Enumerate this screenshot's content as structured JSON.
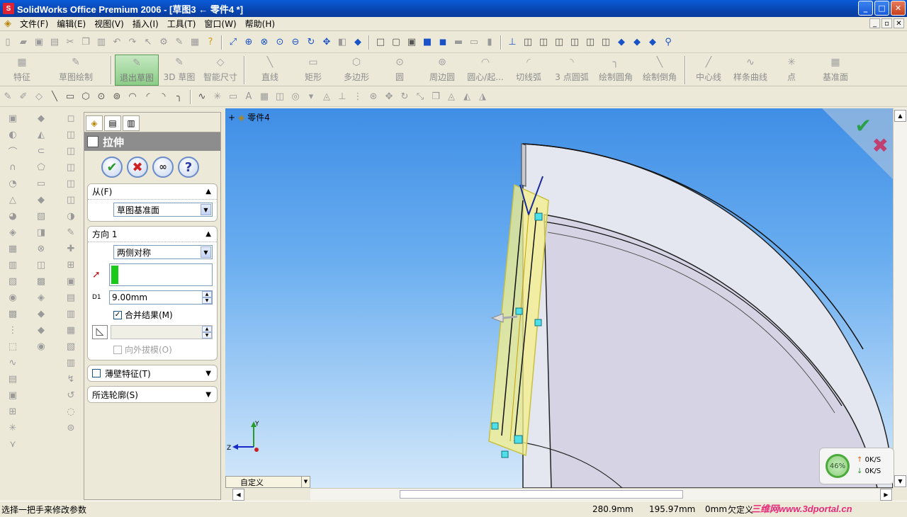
{
  "window": {
    "title": "SolidWorks Office Premium 2006 - [草图3 ← 零件4 *]",
    "app_icon": "S",
    "controls": [
      "_",
      "□",
      "✕"
    ]
  },
  "menu": {
    "items": [
      "文件(F)",
      "编辑(E)",
      "视图(V)",
      "插入(I)",
      "工具(T)",
      "窗口(W)",
      "帮助(H)"
    ],
    "mdi_controls": [
      "_",
      "▫",
      "✕"
    ]
  },
  "command_manager": {
    "buttons": [
      "特征",
      "草图绘制",
      "退出草图",
      "3D 草图",
      "智能尺寸",
      "直线",
      "矩形",
      "多边形",
      "圆",
      "周边圆",
      "圆心/起...",
      "切线弧",
      "3 点圆弧",
      "绘制圆角",
      "绘制倒角",
      "中心线",
      "样条曲线",
      "点",
      "基准面"
    ],
    "active": "退出草图"
  },
  "property_manager": {
    "title": "拉伸",
    "actions": {
      "ok": "✔",
      "cancel": "✖",
      "preview": "∞",
      "help": "?"
    },
    "from": {
      "label": "从(F)",
      "value": "草图基准面"
    },
    "direction1": {
      "label": "方向 1",
      "end_condition": "两侧对称",
      "depth": "9.00mm",
      "depth_icon_label": "D1",
      "merge_result": "合并结果(M)",
      "merge_checked": "✓",
      "draft_outward": "向外拔模(O)"
    },
    "thin_feature": {
      "label": "薄壁特征(T)"
    },
    "selected_contours": {
      "label": "所选轮廓(S)"
    }
  },
  "viewport": {
    "tree_label": "零件4",
    "view_orientation": "自定义",
    "confirm_ok": "✔",
    "confirm_cancel": "✖",
    "triad": {
      "y": "Y",
      "z": "Z"
    }
  },
  "statusbar": {
    "message": "选择一把手来修改参数",
    "x": "280.9mm",
    "y": "195.97mm",
    "z": "0mm",
    "state": "欠定义"
  },
  "netmeter": {
    "percent": "46%",
    "up": "0K/S",
    "down": "0K/S"
  },
  "watermark": "三维网www.3dportal.cn",
  "colors": {
    "titlebar": "#0845b0",
    "viewport_top": "#3f8ee6",
    "selection_green": "#1aca1a",
    "highlight_yellow": "#f5f08a"
  }
}
